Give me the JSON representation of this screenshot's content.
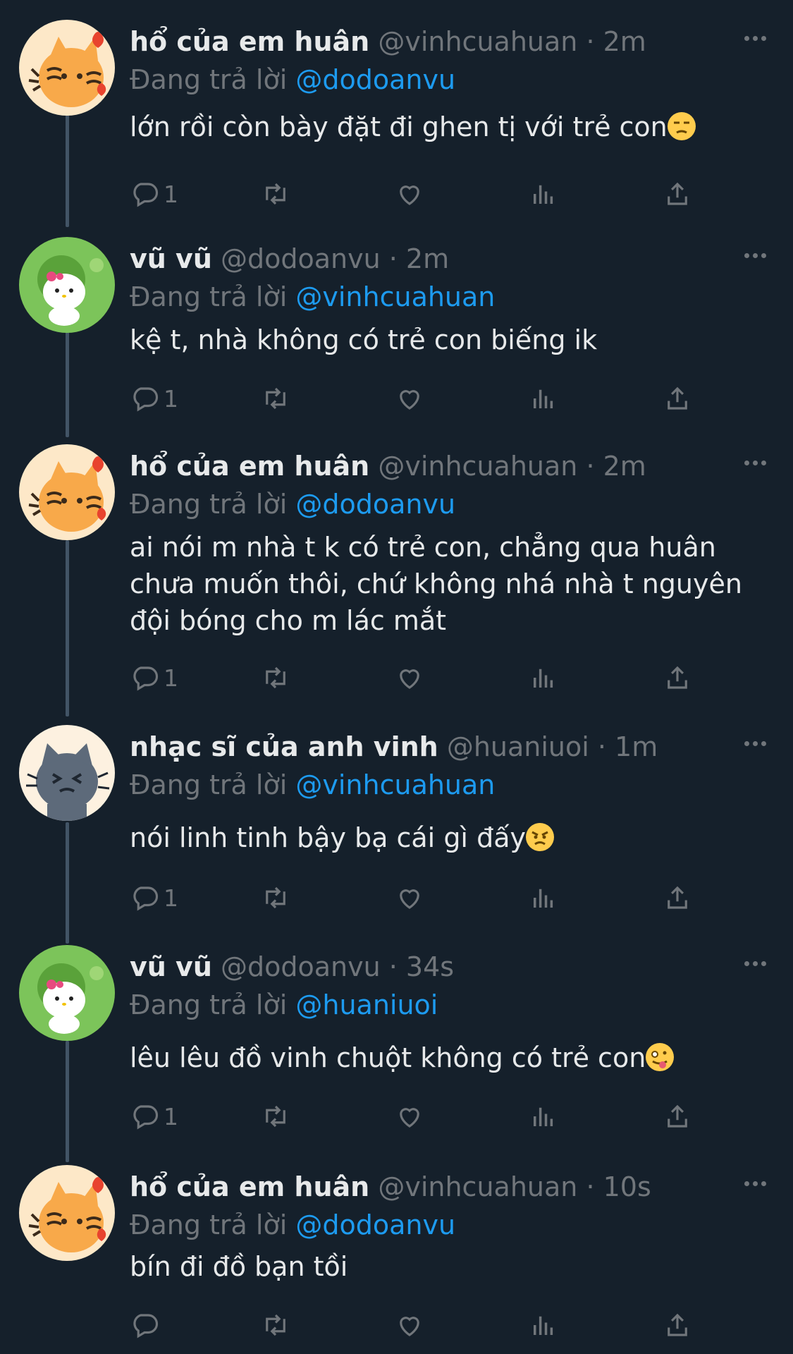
{
  "reply_prefix": "Đang trả lời",
  "tweets": [
    {
      "name": "hổ của em huân",
      "meta": "@vinhcuahuan · 2m",
      "reply_to": "@dodoanvu",
      "text": "lớn rồi còn bày đặt đi ghen tị với trẻ con",
      "emoji": "unamused-face-emoji",
      "reply_count": "1",
      "avatar": "tiger-avatar"
    },
    {
      "name": "vũ vũ",
      "meta": "@dodoanvu · 2m",
      "reply_to": "@vinhcuahuan",
      "text": "kệ t, nhà không có trẻ con biếng ik",
      "emoji": "",
      "reply_count": "1",
      "avatar": "hello-kitty-avatar"
    },
    {
      "name": "hổ của em huân",
      "meta": "@vinhcuahuan · 2m",
      "reply_to": "@dodoanvu",
      "text": "ai nói m nhà t k có trẻ con, chẳng qua huân chưa muốn thôi, chứ không nhá nhà t nguyên đội bóng cho m lác mắt",
      "emoji": "",
      "reply_count": "1",
      "avatar": "tiger-avatar"
    },
    {
      "name": "nhạc sĩ của anh vinh",
      "meta": "@huaniuoi · 1m",
      "reply_to": "@vinhcuahuan",
      "text": "nói linh tinh bậy bạ cái gì đấy",
      "emoji": "angry-face-emoji",
      "reply_count": "1",
      "avatar": "gray-cat-avatar"
    },
    {
      "name": "vũ vũ",
      "meta": "@dodoanvu · 34s",
      "reply_to": "@huaniuoi",
      "text": "lêu lêu đồ vinh chuột không có trẻ con",
      "emoji": "zany-face-emoji",
      "reply_count": "1",
      "avatar": "hello-kitty-avatar"
    },
    {
      "name": "hổ của em huân",
      "meta": "@vinhcuahuan · 10s",
      "reply_to": "@dodoanvu",
      "text": "bín đi đồ bạn tồi",
      "emoji": "",
      "reply_count": "",
      "avatar": "tiger-avatar"
    }
  ],
  "colors": {
    "background": "#15202b",
    "text": "#e7e9ea",
    "muted": "#71767b",
    "link": "#1d9bf0",
    "thread_line": "#425466"
  },
  "icons": [
    "reply-icon",
    "retweet-icon",
    "like-icon",
    "views-icon",
    "share-icon",
    "more-icon"
  ]
}
